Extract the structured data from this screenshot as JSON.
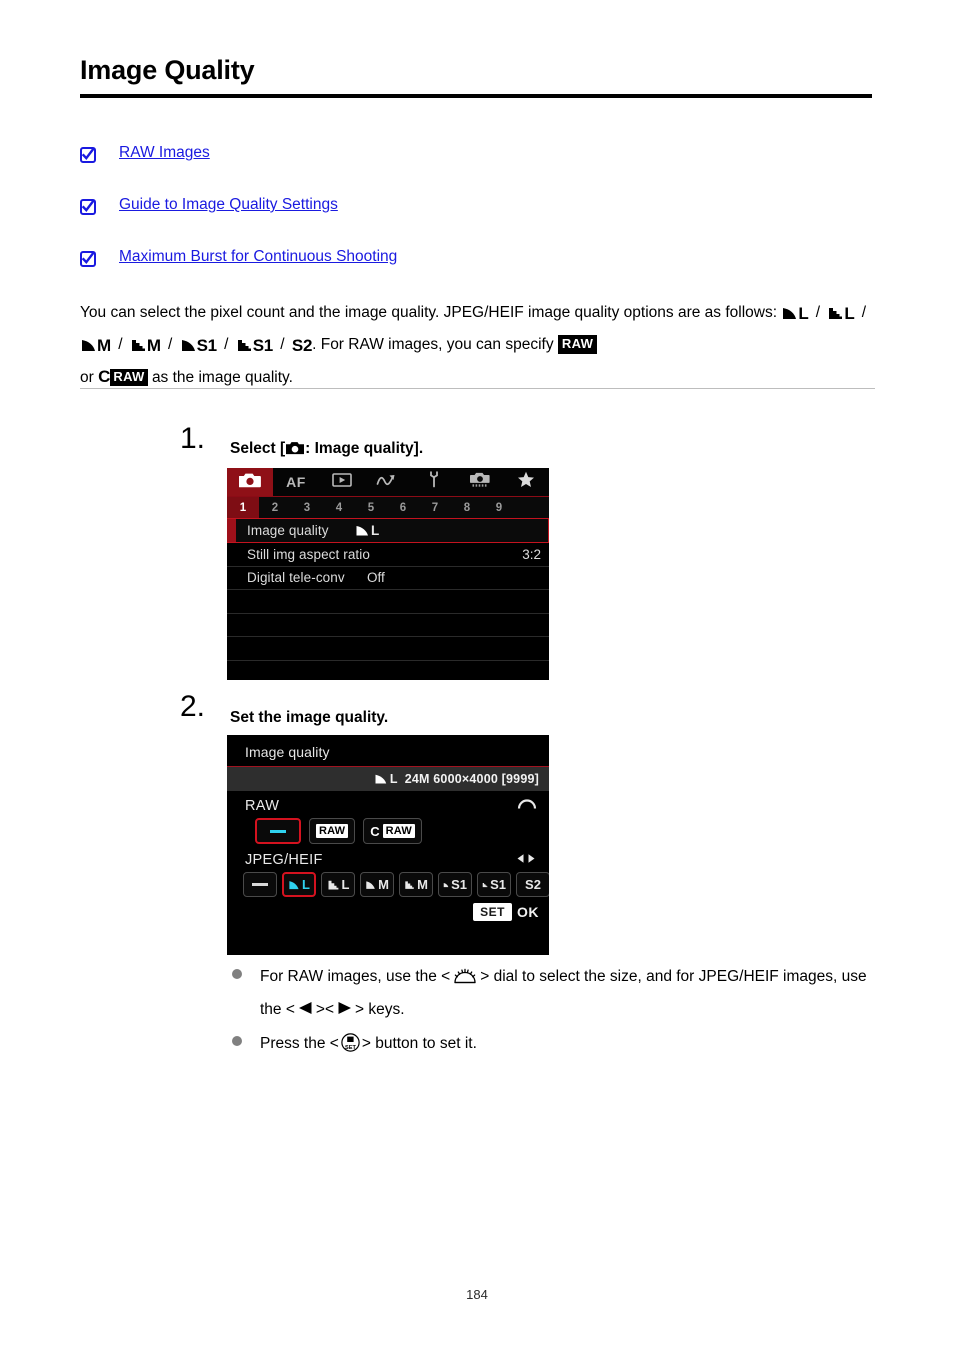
{
  "document": {
    "title": "Image Quality",
    "page_number": "184"
  },
  "links": [
    {
      "icon": "checkbox-check-icon",
      "label": "RAW Images"
    },
    {
      "icon": "checkbox-check-icon",
      "label": "Guide to Image Quality Settings"
    },
    {
      "icon": "checkbox-check-icon",
      "label": "Maximum Burst for Continuous Shooting"
    }
  ],
  "intro": {
    "line1": "You can select the pixel count and the image quality. JPEG/HEIF image quality options are",
    "line2_prefix": "as follows:",
    "quality_options": [
      "L",
      "L",
      "M",
      "M",
      "S1",
      "S1",
      "S2"
    ],
    "quality_styles": [
      "smooth",
      "step",
      "smooth",
      "step",
      "smooth",
      "step",
      "plain"
    ],
    "line2_mid": ". For RAW images, you can specify",
    "raw_label": "RAW",
    "line3_prefix": "or",
    "craw_c": "C",
    "craw_label": "RAW",
    "line3_suffix": "as the image quality."
  },
  "steps": [
    {
      "number": "1.",
      "heading_prefix": "Select [",
      "heading_icon": "camera-icon",
      "heading_suffix": ": Image quality]."
    },
    {
      "number": "2.",
      "heading": "Set the image quality."
    }
  ],
  "menu_screen": {
    "tabs": [
      {
        "name": "shooting-tab",
        "icon": "camera-icon",
        "label": "",
        "active": true
      },
      {
        "name": "af-tab",
        "icon": "af-text-icon",
        "label": "AF",
        "active": false
      },
      {
        "name": "playback-tab",
        "icon": "playback-icon",
        "label": "",
        "active": false
      },
      {
        "name": "network-tab",
        "icon": "network-icon",
        "label": "",
        "active": false
      },
      {
        "name": "setup-tab",
        "icon": "wrench-icon",
        "label": "",
        "active": false
      },
      {
        "name": "custom-functions-tab",
        "icon": "custom-camera-icon",
        "label": "",
        "active": false
      },
      {
        "name": "my-menu-tab",
        "icon": "star-icon",
        "label": "",
        "active": false
      }
    ],
    "page_numbers": [
      "1",
      "2",
      "3",
      "4",
      "5",
      "6",
      "7",
      "8",
      "9"
    ],
    "active_page_number": "1",
    "rows": [
      {
        "label": "Image quality",
        "value": "L",
        "value_style": "smooth",
        "selected": true
      },
      {
        "label": "Still img aspect ratio",
        "value": "3:2",
        "value_align": "right",
        "selected": false
      },
      {
        "label": "Digital tele-conv",
        "value": "Off",
        "value_align": "mid",
        "selected": false
      },
      {
        "label": "",
        "value": "",
        "selected": false
      },
      {
        "label": "",
        "value": "",
        "selected": false
      },
      {
        "label": "",
        "value": "",
        "selected": false
      },
      {
        "label": "",
        "value": "",
        "selected": false
      }
    ]
  },
  "quality_screen": {
    "title": "Image quality",
    "info_quality": "L",
    "info_text": "24M 6000×4000 [9999]",
    "raw_section": {
      "label": "RAW",
      "control_icon": "main-dial-icon",
      "options": [
        {
          "name": "raw-none",
          "type": "dash",
          "label": "",
          "selected": true
        },
        {
          "name": "raw-full",
          "type": "rawbox",
          "label": "RAW",
          "selected": false
        },
        {
          "name": "raw-compact",
          "type": "crawbox",
          "prefix": "C",
          "label": "RAW",
          "selected": false
        }
      ]
    },
    "jpeg_section": {
      "label": "JPEG/HEIF",
      "control_icon": "left-right-keys-icon",
      "options": [
        {
          "name": "jpeg-none",
          "type": "dash",
          "label": "",
          "style": "none",
          "selected": false
        },
        {
          "name": "jpeg-large-fine",
          "label": "L",
          "style": "smooth",
          "selected": true
        },
        {
          "name": "jpeg-large-normal",
          "label": "L",
          "style": "step",
          "selected": false
        },
        {
          "name": "jpeg-medium-fine",
          "label": "M",
          "style": "smooth",
          "selected": false
        },
        {
          "name": "jpeg-medium-normal",
          "label": "M",
          "style": "step",
          "selected": false
        },
        {
          "name": "jpeg-small1-fine",
          "label": "S1",
          "style": "smooth",
          "selected": false
        },
        {
          "name": "jpeg-small1-normal",
          "label": "S1",
          "style": "step",
          "selected": false
        },
        {
          "name": "jpeg-small2",
          "label": "S2",
          "style": "plain",
          "selected": false
        }
      ]
    },
    "confirm": {
      "set_label": "SET",
      "ok_label": "OK"
    }
  },
  "bullets": [
    {
      "part1": "For RAW images, use the <",
      "icon1": "main-dial-icon",
      "part2": "> dial to select the size, and for JPEG/HEIF images, use the <",
      "icon2": "left-arrow-icon",
      "part3": "><",
      "icon3": "right-arrow-icon",
      "part4": "> keys."
    },
    {
      "part1": "Press the <",
      "icon1": "quick-set-button-icon",
      "part2": "> button to set it."
    }
  ],
  "colors": {
    "link": "#1a1ae0",
    "menu_red": "#8f1017",
    "selection_red": "#c4131f",
    "selected_cyan": "#2fd2ef",
    "bullet_gray": "#808080"
  }
}
